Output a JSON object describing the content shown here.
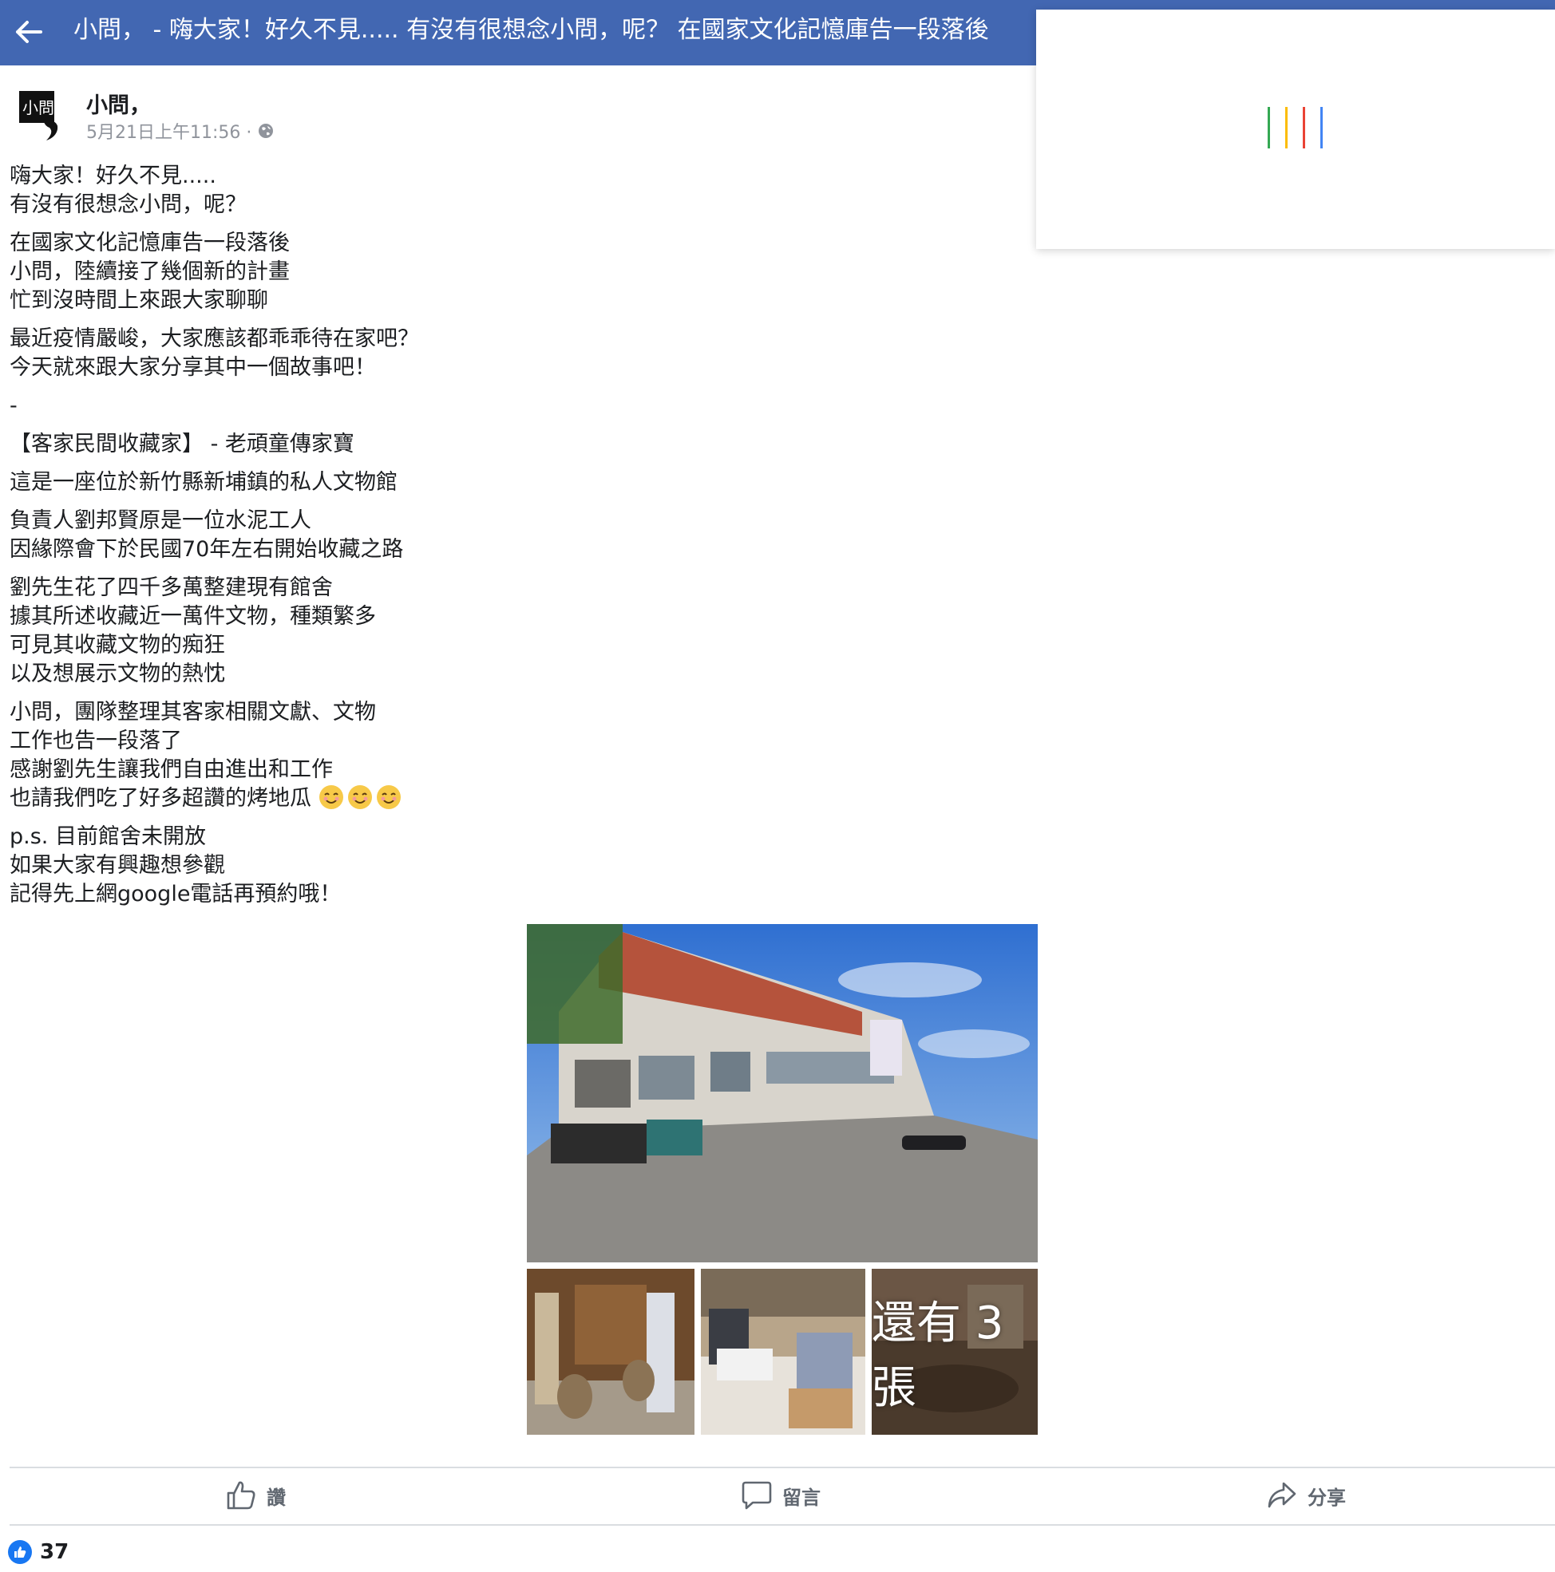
{
  "topbar": {
    "title": "小問， - 嗨大家！好久不見..... 有沒有很想念小問，呢？ 在國家文化記憶庫告一段落後"
  },
  "post": {
    "author": "小問，",
    "avatar_text": "小問",
    "timestamp": "5月21日上午11:56 ·",
    "paragraphs": [
      "嗨大家！好久不見.....\n有沒有很想念小問，呢？",
      "在國家文化記憶庫告一段落後\n小問，陸續接了幾個新的計畫\n忙到沒時間上來跟大家聊聊",
      "最近疫情嚴峻，大家應該都乖乖待在家吧？\n今天就來跟大家分享其中一個故事吧！",
      "-",
      "【客家民間收藏家】 - 老頑童傳家寶",
      "這是一座位於新竹縣新埔鎮的私人文物館",
      "負責人劉邦賢原是一位水泥工人\n因緣際會下於民國70年左右開始收藏之路",
      "劉先生花了四千多萬整建現有館舍\n據其所述收藏近一萬件文物，種類繁多\n可見其收藏文物的痴狂\n以及想展示文物的熱忱",
      "小問，團隊整理其客家相關文獻、文物\n工作也告一段落了\n感謝劉先生讓我們自由進出和工作\n也請我們吃了好多超讚的烤地瓜 ",
      "p.s. 目前館舍未開放\n如果大家有興趣想參觀\n記得先上網google電話再預約哦！"
    ],
    "emoji_name": "smiling-face-emoji",
    "photos": {
      "more_label": "還有 3 張"
    },
    "actions": {
      "like": "讚",
      "comment": "留言",
      "share": "分享"
    },
    "like_count": "37"
  },
  "colors": {
    "topbar": "#4267b2",
    "like_blue": "#1877f2",
    "loader": [
      "#34a853",
      "#fbbc05",
      "#ea4335",
      "#4285f4"
    ]
  }
}
